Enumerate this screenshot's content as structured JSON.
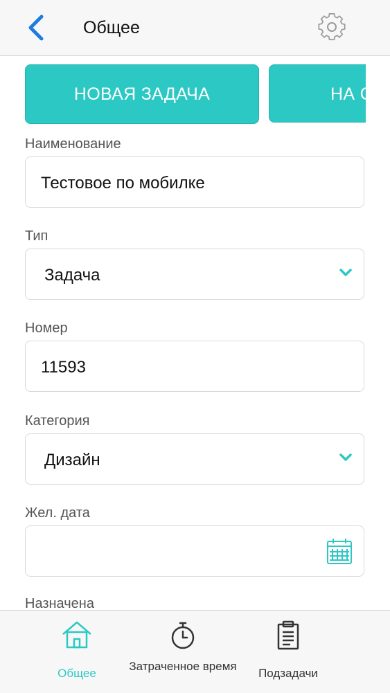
{
  "header": {
    "title": "Общее",
    "back_icon": "chevron-left-icon",
    "settings_icon": "gear-icon"
  },
  "status_buttons": [
    "НОВАЯ ЗАДАЧА",
    "НА С"
  ],
  "form": {
    "name_label": "Наименование",
    "name_value": "Тестовое по мобилке",
    "type_label": "Тип",
    "type_value": "Задача",
    "number_label": "Номер",
    "number_value": "11593",
    "category_label": "Категория",
    "category_value": "Дизайн",
    "date_label": "Жел. дата",
    "date_value": "",
    "assigned_label": "Назначена"
  },
  "tabs": [
    {
      "label": "Общее",
      "icon": "home-icon",
      "active": true
    },
    {
      "label": "Затраченное время",
      "icon": "stopwatch-icon",
      "active": false
    },
    {
      "label": "Подзадачи",
      "icon": "clipboard-icon",
      "active": false
    }
  ],
  "colors": {
    "accent": "#2cc9c4",
    "back_icon": "#1e7be0",
    "header_bg": "#f7f7f7"
  }
}
